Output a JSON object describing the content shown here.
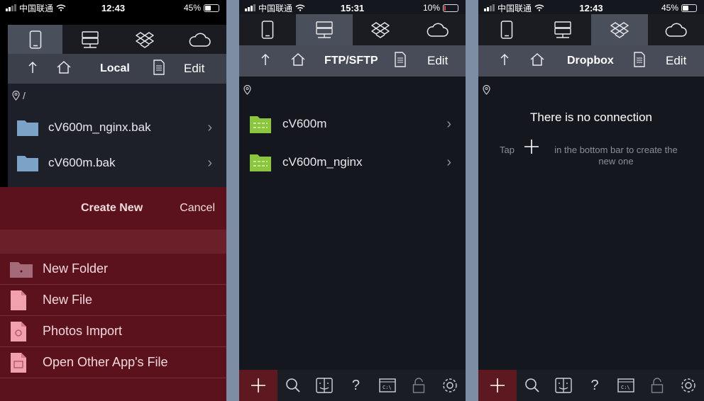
{
  "phones": [
    {
      "status": {
        "carrier": "中国联通",
        "time": "12:43",
        "battery": "45%",
        "battery_level": 0.45
      },
      "tabs": [
        "phone-icon",
        "server-icon",
        "dropbox-icon",
        "cloud-icon"
      ],
      "active_tab": 0,
      "toolbar": {
        "title": "Local",
        "edit": "Edit"
      },
      "path": "/",
      "files": [
        {
          "name": "cV600m_nginx.bak"
        },
        {
          "name": "cV600m.bak"
        }
      ],
      "sheet": {
        "title": "Create New",
        "cancel": "Cancel",
        "items": [
          {
            "label": "New Folder",
            "icon": "folder-icon"
          },
          {
            "label": "New File",
            "icon": "file-icon"
          },
          {
            "label": "Photos Import",
            "icon": "photos-icon"
          },
          {
            "label": "Open Other App's File",
            "icon": "open-file-icon"
          }
        ]
      }
    },
    {
      "status": {
        "carrier": "中国联通",
        "time": "15:31",
        "battery": "10%",
        "battery_level": 0.1
      },
      "active_tab": 1,
      "toolbar": {
        "title": "FTP/SFTP",
        "edit": "Edit"
      },
      "files": [
        {
          "name": "cV600m"
        },
        {
          "name": "cV600m_nginx"
        }
      ]
    },
    {
      "status": {
        "carrier": "中国联通",
        "time": "12:43",
        "battery": "45%",
        "battery_level": 0.45
      },
      "active_tab": 2,
      "toolbar": {
        "title": "Dropbox",
        "edit": "Edit"
      },
      "empty": {
        "title": "There is no connection",
        "tap": "Tap",
        "hint": "in the bottom bar to create the new one"
      }
    }
  ],
  "bottombar": [
    "plus-icon",
    "search-icon",
    "finder-icon",
    "help-icon",
    "terminal-icon",
    "lock-icon",
    "gear-icon"
  ],
  "colors": {
    "accent_red": "#5b121c",
    "ftp_folder": "#8cc63f",
    "local_folder": "#7aa3c7"
  }
}
